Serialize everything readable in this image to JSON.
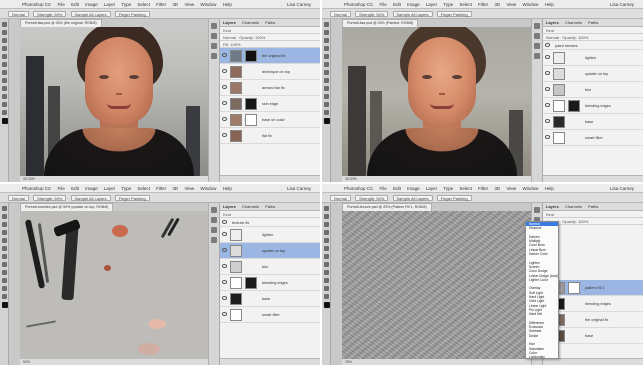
{
  "app": {
    "title": "Adobe Photoshop CC 2018",
    "menu": [
      "Photoshop CC",
      "File",
      "Edit",
      "Image",
      "Layer",
      "Type",
      "Select",
      "Filter",
      "3D",
      "View",
      "Window",
      "Help"
    ],
    "user": "Lisa Carney"
  },
  "options_bar": {
    "mode": "Normal",
    "strength": "Strength: 50%",
    "sample_all": "Sample All Layers",
    "finger": "Finger Painting"
  },
  "panels": {
    "tabs": [
      "Layers",
      "Channels",
      "Paths"
    ],
    "kind_label": "Kind",
    "blend": "Normal",
    "opacity": "Opacity: 100%",
    "fill": "Fill: 100%"
  },
  "q1": {
    "doc_tab": "Portrait-lisa.psd @ 33% (the original, RGB/8)",
    "status": "33.33%",
    "layers": [
      {
        "name": "the original fix",
        "selected": true
      },
      {
        "name": "technique on top"
      },
      {
        "name": "armani fan fix"
      },
      {
        "name": "skin edge"
      },
      {
        "name": "base on color"
      },
      {
        "name": "flat fix"
      }
    ]
  },
  "q2": {
    "doc_tab": "Portrait-lisa.psd @ 33% (Painted, RGB/8)",
    "status": "33.33%",
    "layers": [
      {
        "name": "paint strokes",
        "group": true
      },
      {
        "name": "lighten"
      },
      {
        "name": "update on top"
      },
      {
        "name": "blur"
      },
      {
        "name": "blending edges"
      },
      {
        "name": "base"
      },
      {
        "name": "smart filter"
      }
    ]
  },
  "q3": {
    "doc_tab": "Portrait-brushes.psd @ 50% (update on top, RGB/8)",
    "status": "50%",
    "layers": [
      {
        "name": "texture fix",
        "group": true
      },
      {
        "name": "lighten"
      },
      {
        "name": "update on top",
        "selected": true
      },
      {
        "name": "blur"
      },
      {
        "name": "blending edges"
      },
      {
        "name": "base"
      },
      {
        "name": "smart filter"
      }
    ]
  },
  "q4": {
    "doc_tab": "Portrait-texture.psd @ 25% (Pattern Fill 1, RGB/8)",
    "status": "25%",
    "blend_options": [
      "Normal",
      "Dissolve",
      "",
      "Darken",
      "Multiply",
      "Color Burn",
      "Linear Burn",
      "Darker Color",
      "",
      "Lighten",
      "Screen",
      "Color Dodge",
      "Linear Dodge (Add)",
      "Lighter Color",
      "",
      "Overlay",
      "Soft Light",
      "Hard Light",
      "Vivid Light",
      "Linear Light",
      "Pin Light",
      "Hard Mix",
      "",
      "Difference",
      "Exclusion",
      "Subtract",
      "Divide",
      "",
      "Hue",
      "Saturation",
      "Color",
      "Luminosity"
    ],
    "layers": [
      {
        "name": "pattern fill 1",
        "selected": true
      },
      {
        "name": "blending edges"
      },
      {
        "name": "the original fix"
      },
      {
        "name": "base"
      }
    ]
  },
  "colors": {
    "selection": "#9bb6e2",
    "menu_highlight": "#3b7be0",
    "panel_bg": "#f2f2f2",
    "toolbar_bg": "#d2d2d2"
  }
}
